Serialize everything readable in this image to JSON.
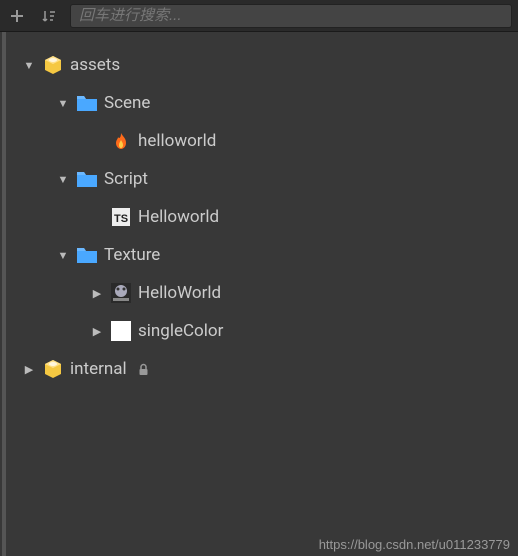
{
  "toolbar": {
    "search_placeholder": "回车进行搜索..."
  },
  "tree": {
    "root1": {
      "label": "assets",
      "locked": false
    },
    "scene_folder": {
      "label": "Scene"
    },
    "scene_item1": {
      "label": "helloworld"
    },
    "script_folder": {
      "label": "Script"
    },
    "script_item1": {
      "label": "Helloworld"
    },
    "texture_folder": {
      "label": "Texture"
    },
    "texture_item1": {
      "label": "HelloWorld"
    },
    "texture_item2": {
      "label": "singleColor"
    },
    "root2": {
      "label": "internal",
      "locked": true
    }
  },
  "watermark": "https://blog.csdn.net/u011233779"
}
